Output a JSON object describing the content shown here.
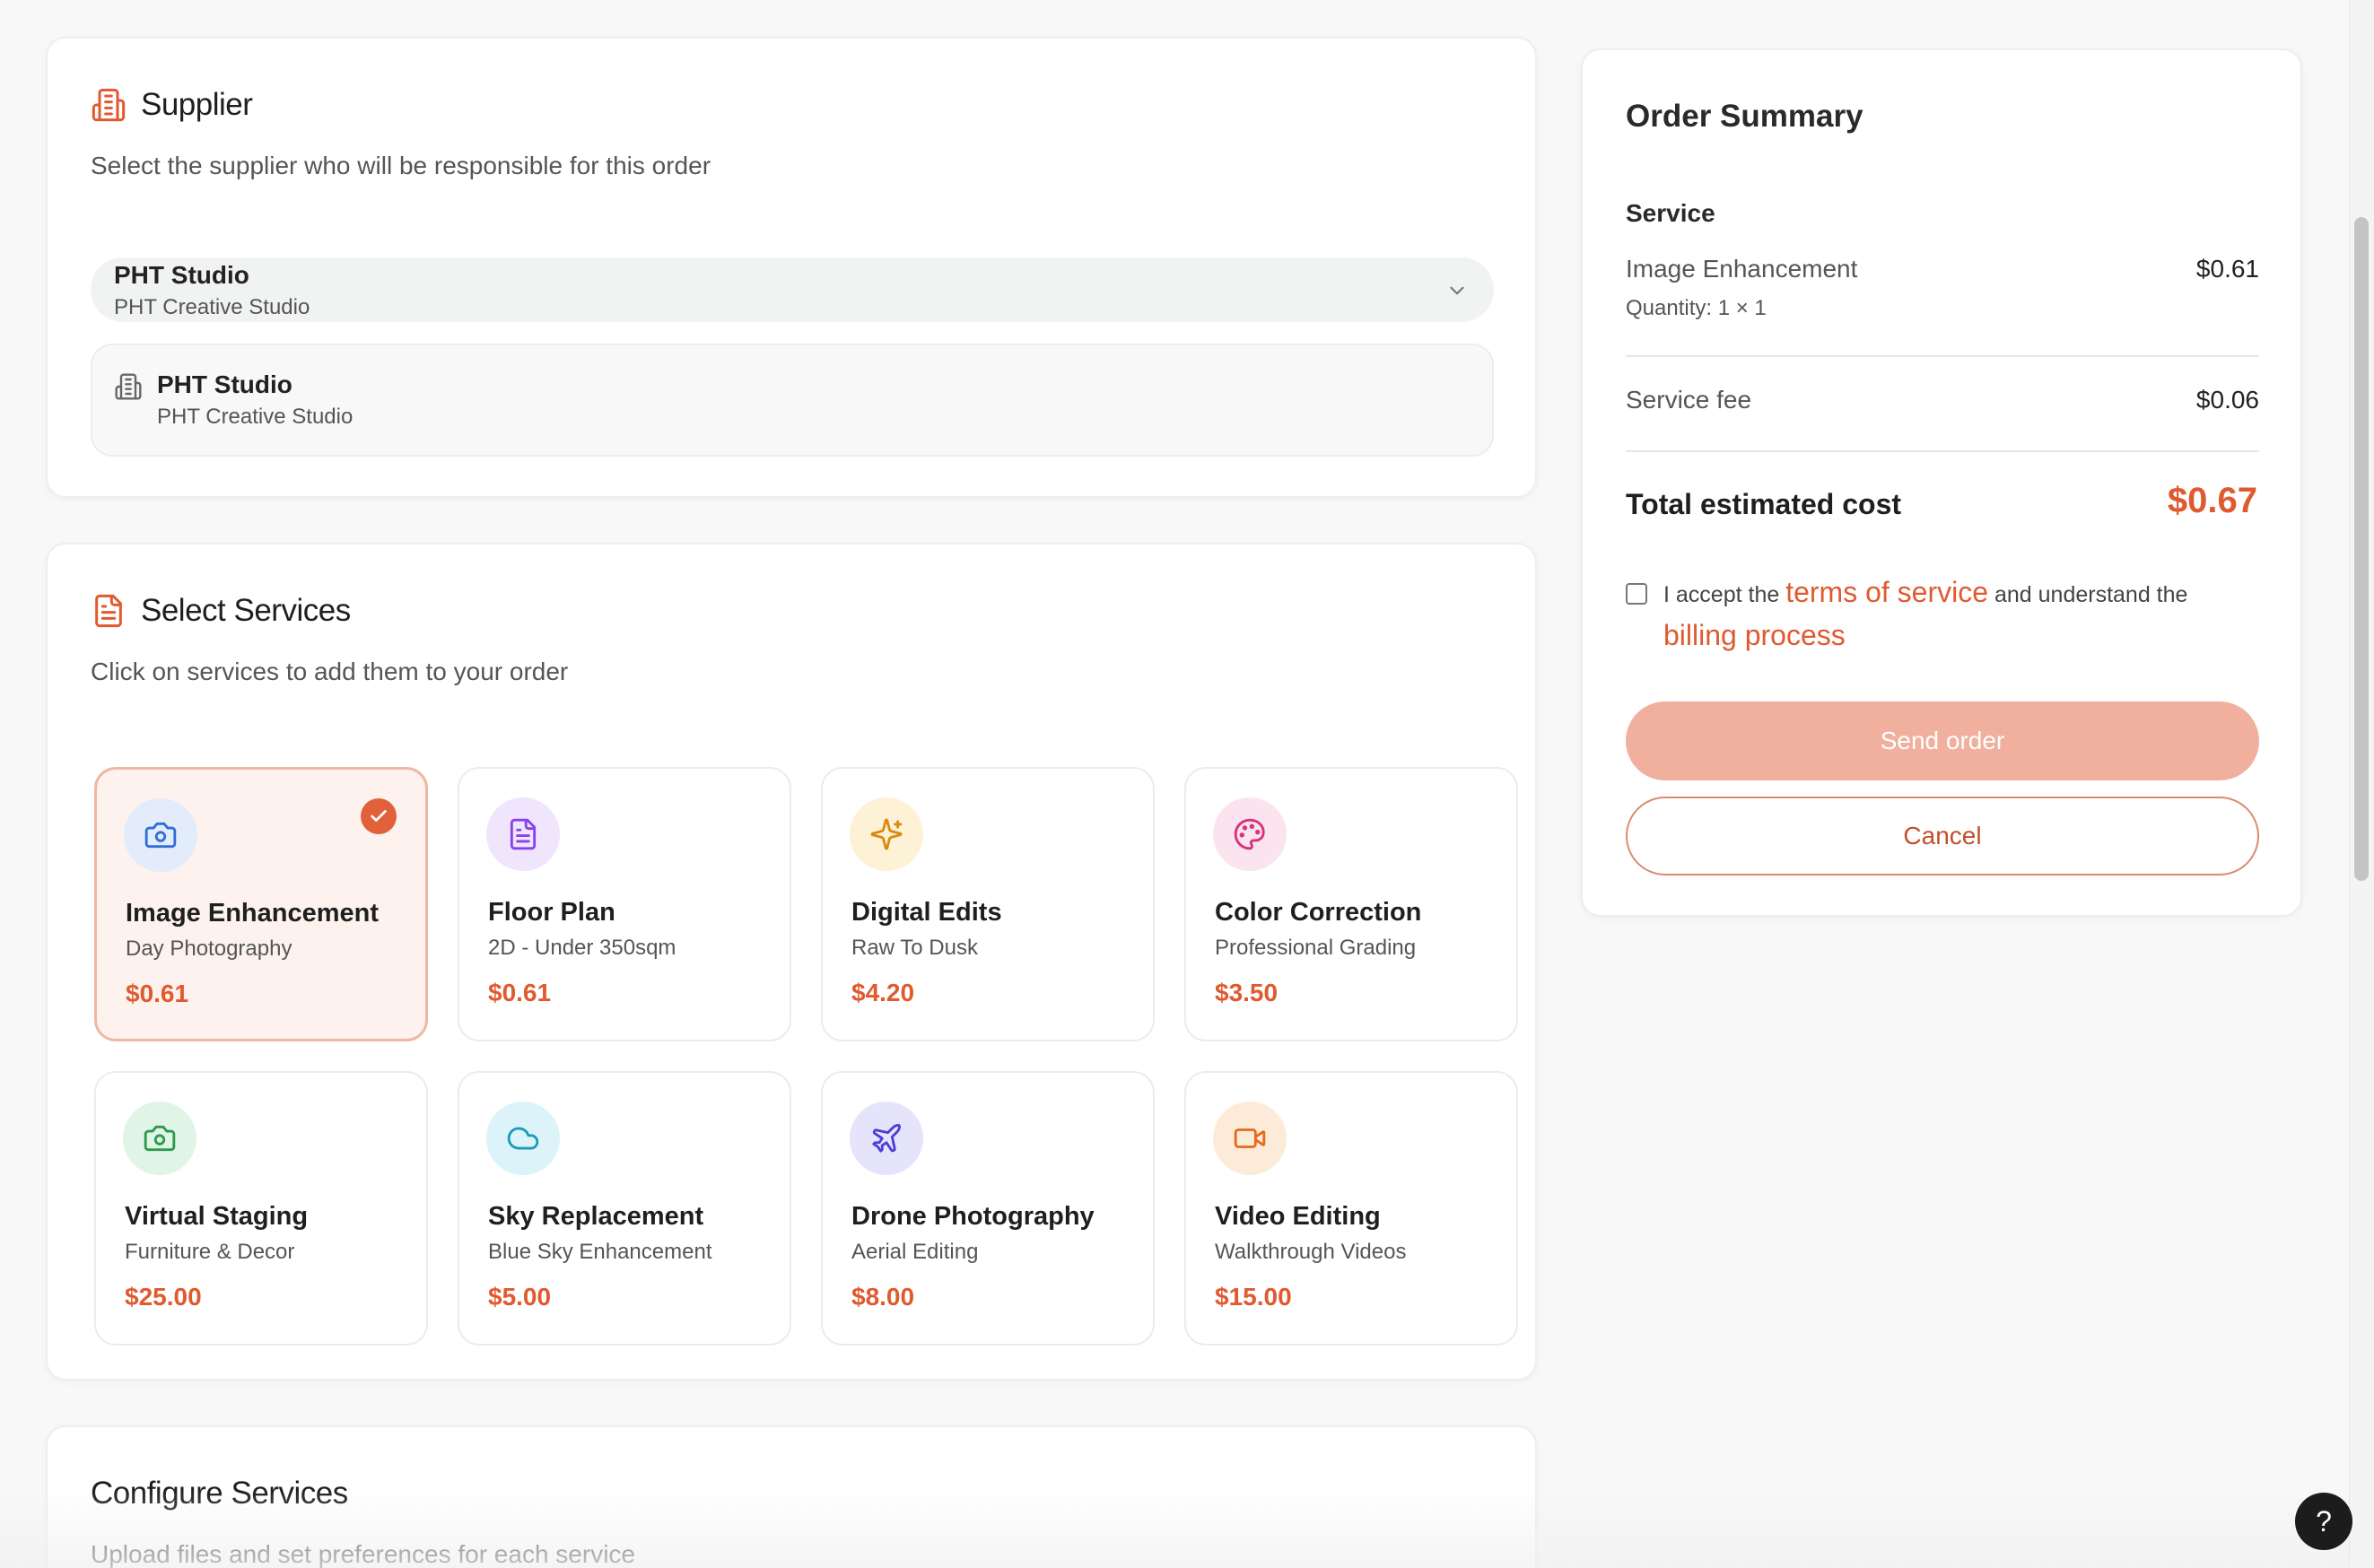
{
  "supplier": {
    "title": "Supplier",
    "subtitle": "Select the supplier who will be responsible for this order",
    "selected_name": "PHT Studio",
    "selected_sub": "PHT Creative Studio",
    "box_name": "PHT Studio",
    "box_sub": "PHT Creative Studio",
    "icon": "building-icon"
  },
  "services": {
    "title": "Select Services",
    "subtitle": "Click on services to add them to your order",
    "items": [
      {
        "name": "Image Enhancement",
        "sub": "Day Photography",
        "price": "$0.61",
        "icon": "camera-icon",
        "color": "#2f6fd6",
        "bg": "#e3ecfb",
        "selected": true
      },
      {
        "name": "Floor Plan",
        "sub": "2D - Under 350sqm",
        "price": "$0.61",
        "icon": "document-icon",
        "color": "#8a3ff0",
        "bg": "#efe6fd",
        "selected": false
      },
      {
        "name": "Digital Edits",
        "sub": "Raw To Dusk",
        "price": "$4.20",
        "icon": "sparkles-icon",
        "color": "#d98b10",
        "bg": "#fdf1d6",
        "selected": false
      },
      {
        "name": "Color Correction",
        "sub": "Professional Grading",
        "price": "$3.50",
        "icon": "palette-icon",
        "color": "#d9307a",
        "bg": "#fbe4ee",
        "selected": false
      },
      {
        "name": "Virtual Staging",
        "sub": "Furniture & Decor",
        "price": "$25.00",
        "icon": "camera-icon",
        "color": "#2c9a4a",
        "bg": "#e0f5e6",
        "selected": false
      },
      {
        "name": "Sky Replacement",
        "sub": "Blue Sky Enhancement",
        "price": "$5.00",
        "icon": "cloud-icon",
        "color": "#1c9ab8",
        "bg": "#dcf4f9",
        "selected": false
      },
      {
        "name": "Drone Photography",
        "sub": "Aerial Editing",
        "price": "$8.00",
        "icon": "plane-icon",
        "color": "#4a3fd8",
        "bg": "#e6e4fb",
        "selected": false
      },
      {
        "name": "Video Editing",
        "sub": "Walkthrough Videos",
        "price": "$15.00",
        "icon": "video-icon",
        "color": "#e56a1a",
        "bg": "#fdebd9",
        "selected": false
      }
    ]
  },
  "configure": {
    "title": "Configure Services",
    "subtitle": "Upload files and set preferences for each service"
  },
  "summary": {
    "title": "Order Summary",
    "service_label": "Service",
    "line_name": "Image Enhancement",
    "line_price": "$0.61",
    "line_qty": "Quantity: 1 × 1",
    "fee_label": "Service fee",
    "fee_value": "$0.06",
    "total_label": "Total estimated cost",
    "total_value": "$0.67",
    "terms_prefix": "I accept the ",
    "terms_link": "terms of service",
    "terms_mid": " and understand the",
    "billing_link": "billing process",
    "send_label": "Send order",
    "cancel_label": "Cancel"
  },
  "help": {
    "label": "?"
  },
  "colors": {
    "accent": "#e05a30",
    "accent_light": "#f1b09e"
  }
}
